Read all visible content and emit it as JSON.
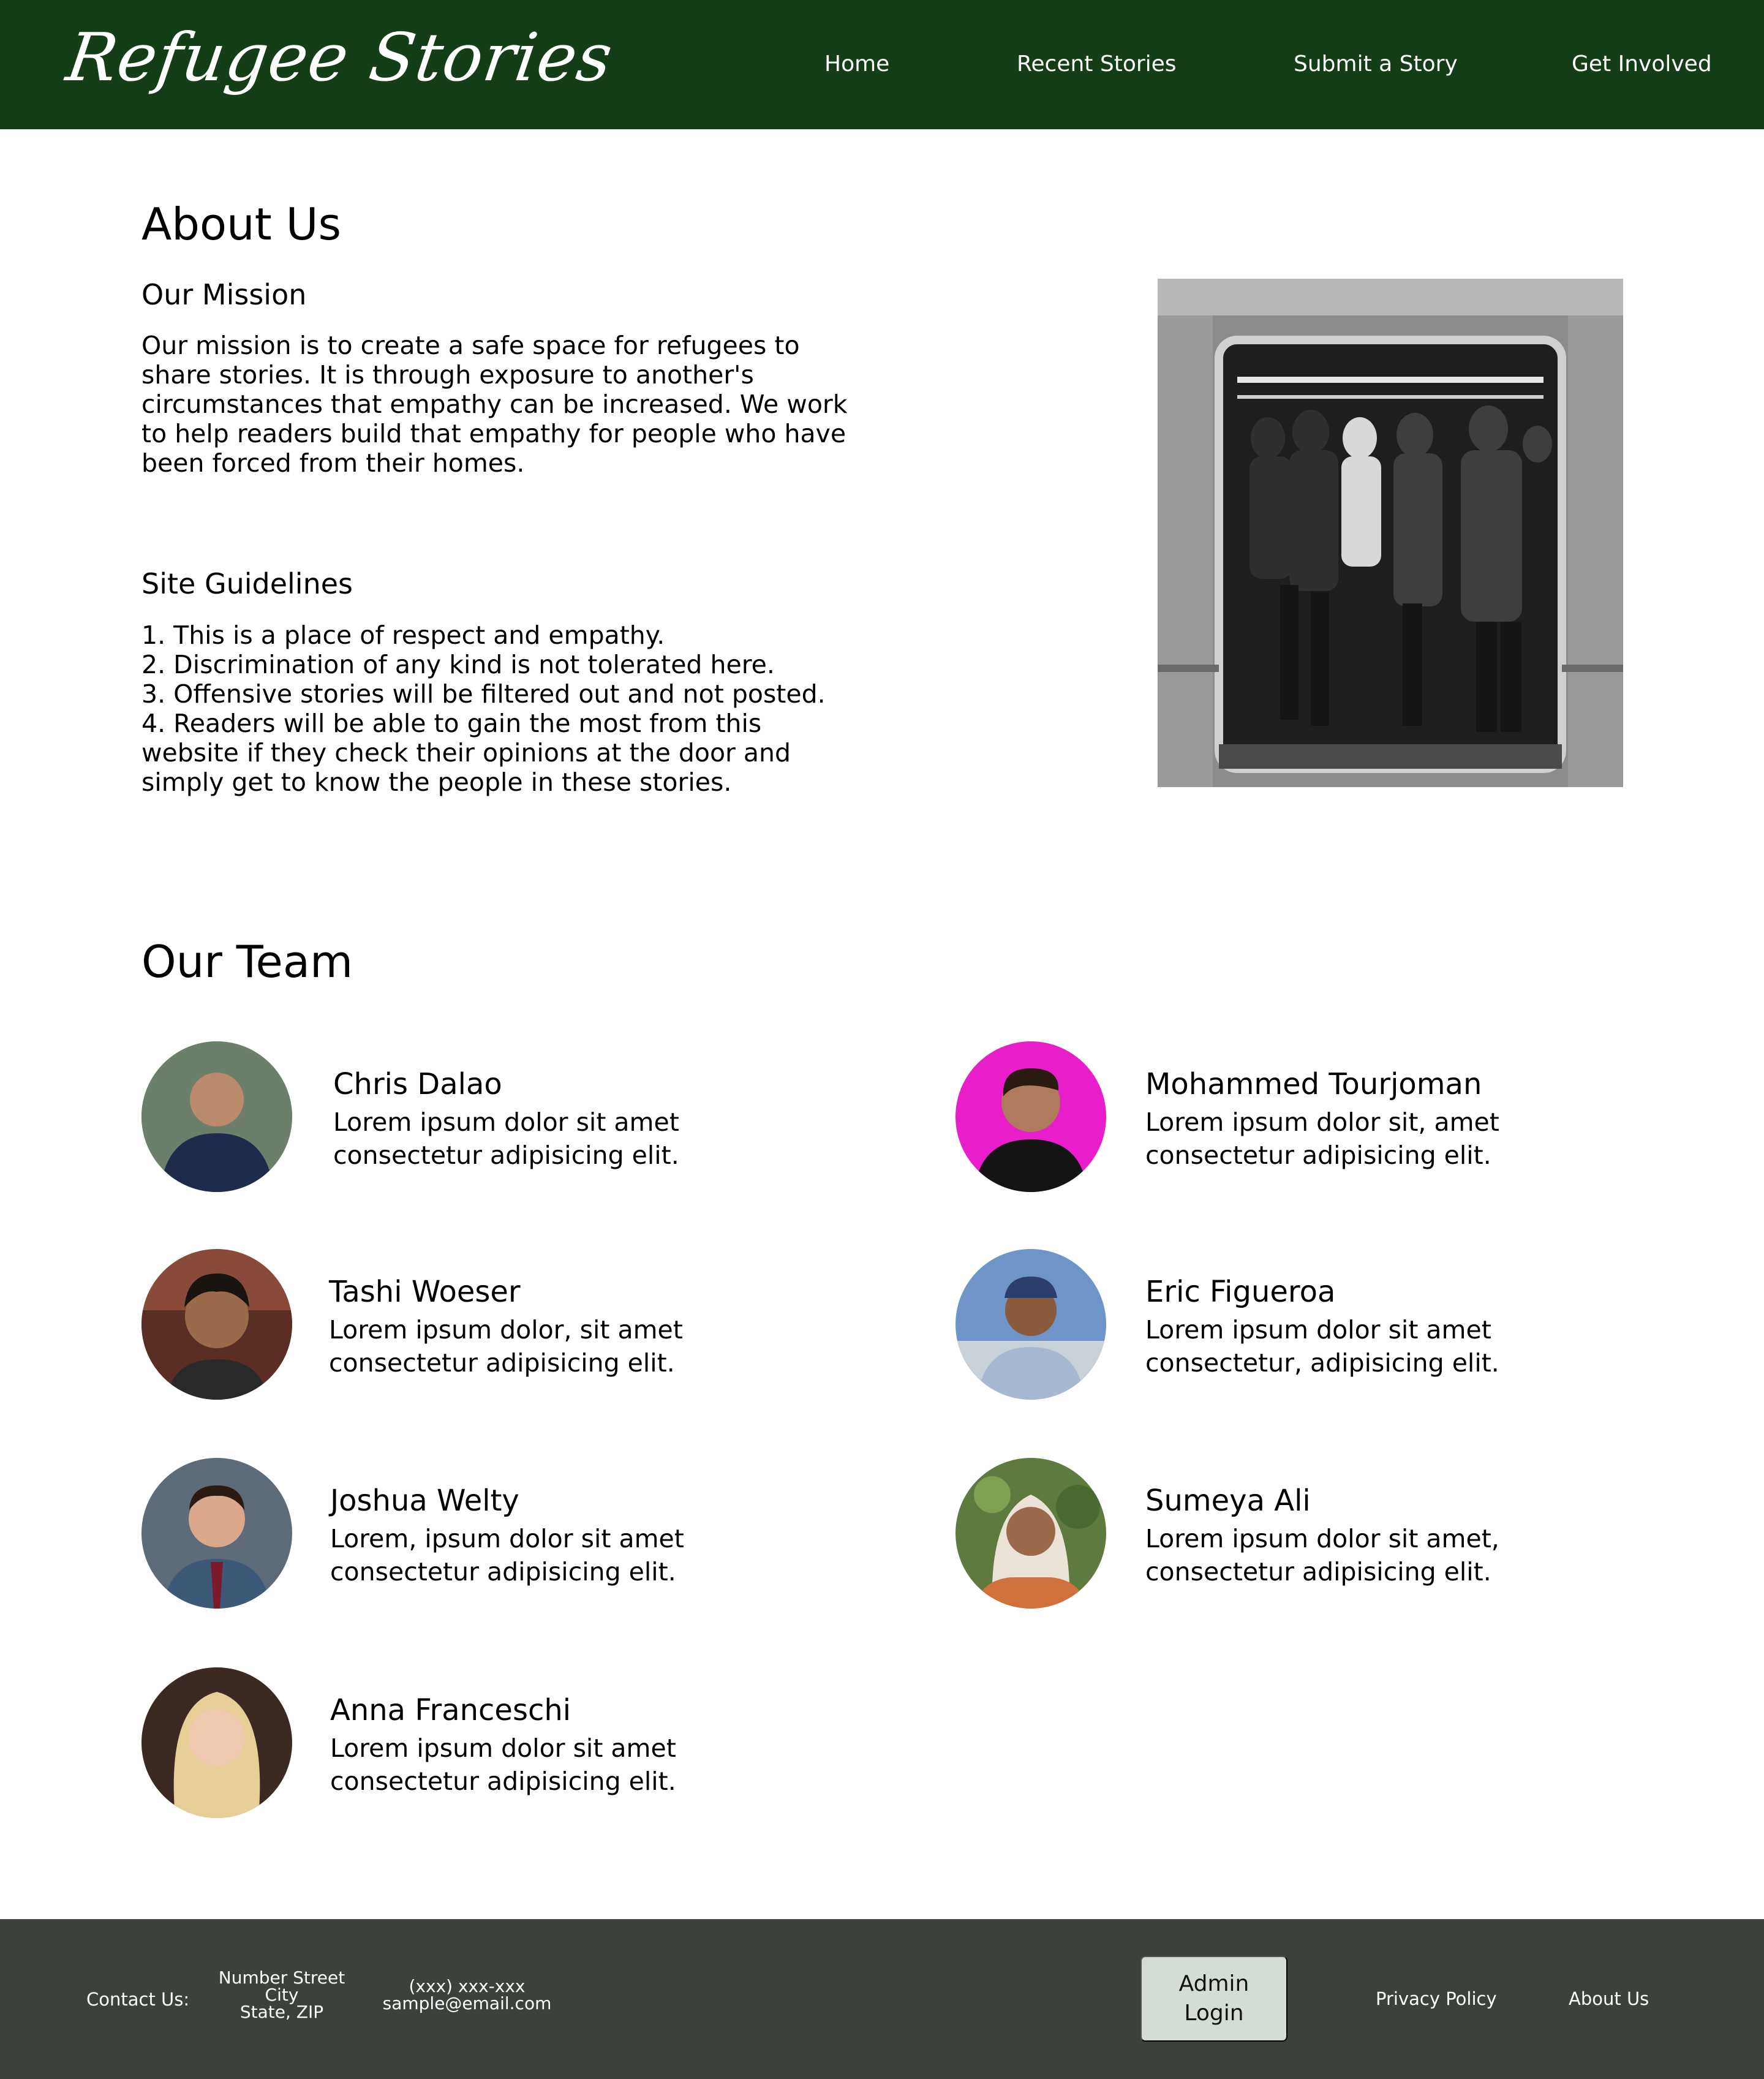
{
  "header": {
    "logo_text": "Refugee Stories",
    "nav": [
      {
        "label": "Home"
      },
      {
        "label": "Recent Stories"
      },
      {
        "label": "Submit a Story"
      },
      {
        "label": "Get Involved"
      }
    ],
    "background_color": "#133e17"
  },
  "about": {
    "title": "About Us",
    "mission_heading": "Our Mission",
    "mission_text": "Our mission is to create a safe space for refugees to share stories. It is through exposure to another's circumstances that empathy can be increased. We work to help readers build that empathy for people who have been forced from their homes.",
    "guidelines_heading": "Site Guidelines",
    "guidelines": [
      "1. This is a place of respect and empathy.",
      "2. Discrimination of any kind is not tolerated here.",
      "3. Offensive stories will be filtered out and not posted.",
      "4. Readers will be able to gain the most from this website if they check their opinions at the door and simply get to know the people in these stories."
    ],
    "image": "crowded-subway-car-photo"
  },
  "team": {
    "title": "Our Team",
    "members": [
      {
        "name": "Chris Dalao",
        "desc": "Lorem ipsum dolor sit amet consectetur adipisicing elit.",
        "avatar_bg": "#6b7f6a"
      },
      {
        "name": "Mohammed Tourjoman",
        "desc": "Lorem ipsum dolor sit, amet consectetur adipisicing elit.",
        "avatar_bg": "#e81ecb"
      },
      {
        "name": "Tashi Woeser",
        "desc": "Lorem ipsum dolor, sit amet consectetur adipisicing elit.",
        "avatar_bg": "#8a4a3a"
      },
      {
        "name": "Eric Figueroa",
        "desc": "Lorem ipsum dolor sit amet consectetur, adipisicing elit.",
        "avatar_bg": "#6f95c8"
      },
      {
        "name": "Joshua Welty",
        "desc": "Lorem, ipsum dolor sit amet consectetur adipisicing elit.",
        "avatar_bg": "#5d6b78"
      },
      {
        "name": "Sumeya Ali",
        "desc": "Lorem ipsum dolor sit amet, consectetur adipisicing elit.",
        "avatar_bg": "#5f7a3f"
      },
      {
        "name": "Anna Franceschi",
        "desc": "Lorem ipsum dolor sit amet consectetur adipisicing elit.",
        "avatar_bg": "#c9a57a"
      }
    ]
  },
  "footer": {
    "contact_label": "Contact Us:",
    "address": [
      "Number Street",
      "City",
      "State, ZIP"
    ],
    "phone": "(xxx) xxx-xxx",
    "email": "sample@email.com",
    "admin_button": [
      "Admin",
      "Login"
    ],
    "privacy_link": "Privacy Policy",
    "about_link": "About Us",
    "background_color": "#3c413c"
  }
}
